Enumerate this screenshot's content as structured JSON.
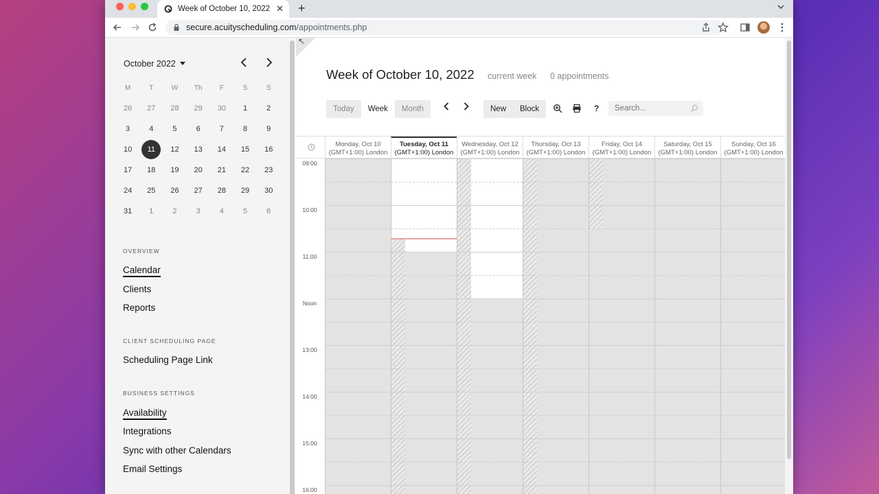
{
  "browser": {
    "tab_title": "Week of October 10, 2022",
    "url_host": "secure.acuityscheduling.com",
    "url_path": "/appointments.php"
  },
  "mini_calendar": {
    "month_label": "October 2022",
    "weekdays": [
      "M",
      "T",
      "W",
      "Th",
      "F",
      "S",
      "S"
    ],
    "weeks": [
      [
        "26",
        "27",
        "28",
        "29",
        "30",
        "1",
        "2"
      ],
      [
        "3",
        "4",
        "5",
        "6",
        "7",
        "8",
        "9"
      ],
      [
        "10",
        "11",
        "12",
        "13",
        "14",
        "15",
        "16"
      ],
      [
        "17",
        "18",
        "19",
        "20",
        "21",
        "22",
        "23"
      ],
      [
        "24",
        "25",
        "26",
        "27",
        "28",
        "29",
        "30"
      ],
      [
        "31",
        "1",
        "2",
        "3",
        "4",
        "5",
        "6"
      ]
    ],
    "today": "11"
  },
  "sidebar": {
    "overview_label": "OVERVIEW",
    "overview_items": [
      "Calendar",
      "Clients",
      "Reports"
    ],
    "client_page_label": "CLIENT SCHEDULING PAGE",
    "client_page_items": [
      "Scheduling Page Link"
    ],
    "business_label": "BUSINESS SETTINGS",
    "business_items": [
      "Availability",
      "Integrations",
      "Sync with other Calendars",
      "Email Settings"
    ]
  },
  "header": {
    "title": "Week of October 10, 2022",
    "current_week": "current week",
    "appointments": "0 appointments"
  },
  "toolbar": {
    "today": "Today",
    "week": "Week",
    "month": "Month",
    "new": "New",
    "block": "Block",
    "help": "?",
    "search_placeholder": "Search..."
  },
  "calendar": {
    "days": [
      {
        "name": "Monday, Oct 10",
        "tz": "(GMT+1:00) London"
      },
      {
        "name": "Tuesday, Oct 11",
        "tz": "(GMT+1:00) London"
      },
      {
        "name": "Wednesday, Oct 12",
        "tz": "(GMT+1:00) London"
      },
      {
        "name": "Thursday, Oct 13",
        "tz": "(GMT+1:00) London"
      },
      {
        "name": "Friday, Oct 14",
        "tz": "(GMT+1:00) London"
      },
      {
        "name": "Saturday, Oct 15",
        "tz": "(GMT+1:00) London"
      },
      {
        "name": "Sunday, Oct 16",
        "tz": "(GMT+1:00) London"
      }
    ],
    "hours": [
      "09:00",
      "10:00",
      "11:00",
      "Noon",
      "13:00",
      "14:00",
      "15:00",
      "16:00"
    ]
  },
  "colors": {
    "accent_dark": "#333333",
    "now_line": "#e8a3a3"
  }
}
